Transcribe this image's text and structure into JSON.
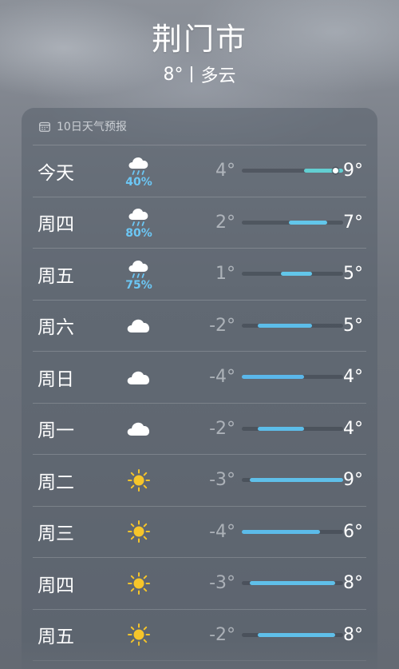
{
  "header": {
    "city": "荆门市",
    "temp": "8°",
    "condition": "多云"
  },
  "forecast": {
    "title": "10日天气预报",
    "scale": {
      "min": -4,
      "max": 9
    },
    "days": [
      {
        "day": "今天",
        "icon": "rain-cloud-icon",
        "prob": "40%",
        "low": "4°",
        "high": "9°",
        "lowVal": 4,
        "highVal": 9,
        "current": 8,
        "barColor": "#62cfd2"
      },
      {
        "day": "周四",
        "icon": "rain-cloud-icon",
        "prob": "80%",
        "low": "2°",
        "high": "7°",
        "lowVal": 2,
        "highVal": 7,
        "barColor": "#62c6ea"
      },
      {
        "day": "周五",
        "icon": "rain-cloud-icon",
        "prob": "75%",
        "low": "1°",
        "high": "5°",
        "lowVal": 1,
        "highVal": 5,
        "barColor": "#62c6ea"
      },
      {
        "day": "周六",
        "icon": "cloud-icon",
        "low": "-2°",
        "high": "5°",
        "lowVal": -2,
        "highVal": 5,
        "barColor": "#5cbde9"
      },
      {
        "day": "周日",
        "icon": "cloud-icon",
        "low": "-4°",
        "high": "4°",
        "lowVal": -4,
        "highVal": 4,
        "barColor": "#5ab7ea"
      },
      {
        "day": "周一",
        "icon": "cloud-icon",
        "low": "-2°",
        "high": "4°",
        "lowVal": -2,
        "highVal": 4,
        "barColor": "#5cbde9"
      },
      {
        "day": "周二",
        "icon": "sun-icon",
        "low": "-3°",
        "high": "9°",
        "lowVal": -3,
        "highVal": 9,
        "barColor": "#5fbfe9"
      },
      {
        "day": "周三",
        "icon": "sun-icon",
        "low": "-4°",
        "high": "6°",
        "lowVal": -4,
        "highVal": 6,
        "barColor": "#5cbbe9"
      },
      {
        "day": "周四",
        "icon": "sun-icon",
        "low": "-3°",
        "high": "8°",
        "lowVal": -3,
        "highVal": 8,
        "barColor": "#5fbfe9"
      },
      {
        "day": "周五",
        "icon": "sun-icon",
        "low": "-2°",
        "high": "8°",
        "lowVal": -2,
        "highVal": 8,
        "barColor": "#5fbfe9"
      }
    ]
  }
}
